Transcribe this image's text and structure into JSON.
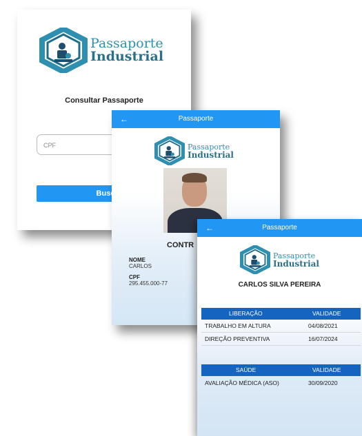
{
  "colors": {
    "primary": "#2196f3",
    "table_header": "#1565c0",
    "logo": "#2f8fb0"
  },
  "logo": {
    "line1": "Passaporte",
    "line2": "Industrial",
    "icon": "hexagon-worker-icon"
  },
  "screen1": {
    "title": "Consultar Passaporte",
    "cpf_placeholder": "CPF",
    "search_label": "Busc"
  },
  "screen2": {
    "appbar_title": "Passaporte",
    "back_icon": "arrow-left-icon",
    "contr_label": "CONTR",
    "name_label": "NOME",
    "name_value": "CARLOS",
    "cpf_label": "CPF",
    "cpf_value": "295.455.000-77"
  },
  "screen3": {
    "appbar_title": "Passaporte",
    "back_icon": "arrow-left-icon",
    "full_name": "CARLOS SILVA PEREIRA",
    "liberacao": {
      "header": "LIBERAÇÃO",
      "validity_header": "VALIDADE",
      "rows": [
        {
          "name": "TRABALHO EM ALTURA",
          "date": "04/08/2021"
        },
        {
          "name": "DIREÇÃO PREVENTIVA",
          "date": "16/07/2024"
        }
      ]
    },
    "saude": {
      "header": "SAÚDE",
      "validity_header": "VALIDADE",
      "rows": [
        {
          "name": "AVALIAÇÃO MÉDICA (ASO)",
          "date": "30/09/2020"
        }
      ]
    }
  }
}
